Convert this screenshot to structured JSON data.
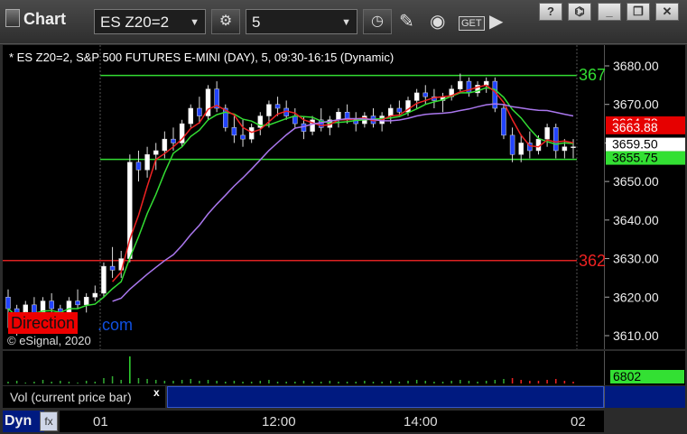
{
  "app": {
    "title": "Chart"
  },
  "toolbar": {
    "symbol": "ES Z20=2",
    "interval": "5",
    "get_label": "GET"
  },
  "window_buttons": {
    "help": "?",
    "restore": "❐",
    "close": "✕"
  },
  "chart": {
    "header": "* ES Z20=2, S&P 500 FUTURES E-MINI (DAY), 5, 09:30-16:15 (Dynamic)",
    "copyright": "© eSignal, 2020",
    "watermark_red": "Direction",
    "watermark_blue": ".com",
    "level_upper_label": "367",
    "level_lower_label": "362"
  },
  "price_axis": {
    "ticks": [
      "3680.00",
      "3670.00",
      "3660.00",
      "3650.00",
      "3640.00",
      "3630.00",
      "3620.00",
      "3610.00"
    ],
    "badges": [
      {
        "label": "3664.78",
        "bg": "#e60000",
        "fg": "#ffffff"
      },
      {
        "label": "3663.88",
        "bg": "#e60000",
        "fg": "#ffffff"
      },
      {
        "label": "3659.50",
        "bg": "#ffffff",
        "fg": "#000000"
      },
      {
        "label": "3655.75",
        "bg": "#33e033",
        "fg": "#000000"
      }
    ]
  },
  "volume": {
    "legend": "Vol (current price bar)",
    "close": "x",
    "value": "6802",
    "value_bg": "#33e033"
  },
  "bottom": {
    "dyn_label": "Dyn",
    "dyn_icon_label": "fx",
    "time_labels": [
      "01",
      "12:00",
      "14:00",
      "02"
    ]
  },
  "chart_data": {
    "type": "candlestick",
    "x_labels": [
      "01",
      "12:00",
      "14:00",
      "02"
    ],
    "ylim": [
      3605,
      3685
    ],
    "horizontal_levels": [
      {
        "price": 3677.5,
        "color": "#33dd33"
      },
      {
        "price": 3655.75,
        "color": "#33dd33"
      },
      {
        "price": 3629.5,
        "color": "#dd2222"
      }
    ],
    "candles": [
      [
        3620,
        3622,
        3612,
        3617
      ],
      [
        3617,
        3618,
        3610,
        3613
      ],
      [
        3613,
        3619,
        3612,
        3618
      ],
      [
        3618,
        3620,
        3614,
        3615
      ],
      [
        3615,
        3620,
        3614,
        3619
      ],
      [
        3619,
        3621,
        3616,
        3617
      ],
      [
        3617,
        3618,
        3612,
        3614
      ],
      [
        3614,
        3620,
        3613,
        3619
      ],
      [
        3619,
        3622,
        3617,
        3618
      ],
      [
        3618,
        3621,
        3616,
        3620
      ],
      [
        3620,
        3623,
        3619,
        3621
      ],
      [
        3621,
        3629,
        3620,
        3628
      ],
      [
        3628,
        3633,
        3625,
        3627
      ],
      [
        3627,
        3632,
        3625,
        3630
      ],
      [
        3630,
        3657,
        3629,
        3655
      ],
      [
        3655,
        3658,
        3650,
        3653
      ],
      [
        3653,
        3659,
        3651,
        3657
      ],
      [
        3657,
        3660,
        3653,
        3658
      ],
      [
        3658,
        3663,
        3656,
        3661
      ],
      [
        3661,
        3664,
        3658,
        3660
      ],
      [
        3660,
        3666,
        3659,
        3665
      ],
      [
        3665,
        3670,
        3664,
        3669
      ],
      [
        3669,
        3672,
        3665,
        3667
      ],
      [
        3667,
        3675,
        3666,
        3674
      ],
      [
        3674,
        3676,
        3668,
        3669
      ],
      [
        3669,
        3670,
        3663,
        3664
      ],
      [
        3664,
        3667,
        3660,
        3662
      ],
      [
        3662,
        3666,
        3659,
        3661
      ],
      [
        3661,
        3665,
        3660,
        3664
      ],
      [
        3664,
        3668,
        3662,
        3667
      ],
      [
        3667,
        3671,
        3664,
        3670
      ],
      [
        3670,
        3672,
        3667,
        3669
      ],
      [
        3669,
        3671,
        3666,
        3667
      ],
      [
        3667,
        3669,
        3664,
        3665
      ],
      [
        3665,
        3667,
        3661,
        3663
      ],
      [
        3663,
        3667,
        3662,
        3666
      ],
      [
        3666,
        3669,
        3663,
        3664
      ],
      [
        3664,
        3667,
        3662,
        3666
      ],
      [
        3666,
        3669,
        3664,
        3668
      ],
      [
        3668,
        3670,
        3665,
        3666
      ],
      [
        3666,
        3668,
        3663,
        3665
      ],
      [
        3665,
        3668,
        3664,
        3667
      ],
      [
        3667,
        3669,
        3664,
        3665
      ],
      [
        3665,
        3668,
        3663,
        3667
      ],
      [
        3667,
        3670,
        3665,
        3669
      ],
      [
        3669,
        3671,
        3667,
        3668
      ],
      [
        3668,
        3672,
        3667,
        3671
      ],
      [
        3671,
        3674,
        3669,
        3673
      ],
      [
        3673,
        3675,
        3670,
        3672
      ],
      [
        3672,
        3674,
        3669,
        3671
      ],
      [
        3671,
        3673,
        3668,
        3672
      ],
      [
        3672,
        3675,
        3671,
        3674
      ],
      [
        3674,
        3678,
        3673,
        3676
      ],
      [
        3676,
        3677,
        3672,
        3673
      ],
      [
        3673,
        3676,
        3672,
        3675
      ],
      [
        3675,
        3677,
        3673,
        3676
      ],
      [
        3676,
        3677,
        3668,
        3669
      ],
      [
        3669,
        3670,
        3661,
        3662
      ],
      [
        3662,
        3664,
        3655,
        3657
      ],
      [
        3657,
        3662,
        3655,
        3660
      ],
      [
        3660,
        3663,
        3656,
        3658
      ],
      [
        3658,
        3662,
        3657,
        3661
      ],
      [
        3661,
        3665,
        3659,
        3664
      ],
      [
        3664,
        3665,
        3656,
        3658
      ],
      [
        3658,
        3661,
        3656,
        3659
      ],
      [
        3659,
        3661,
        3656,
        3659
      ]
    ],
    "volume_value": 6802
  }
}
